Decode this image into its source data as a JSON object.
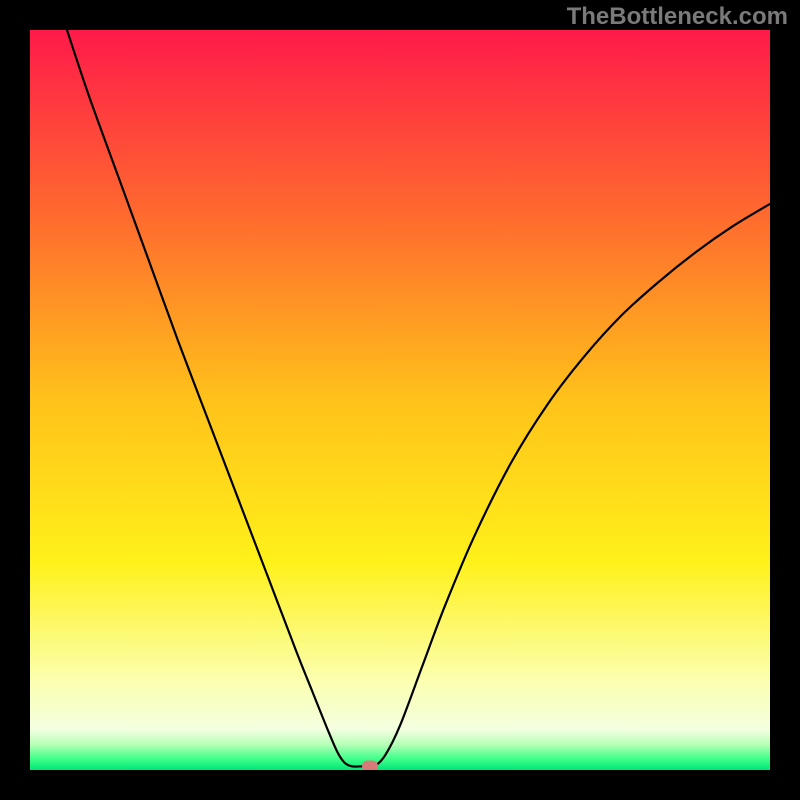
{
  "watermark": "TheBottleneck.com",
  "chart_data": {
    "type": "line",
    "title": "",
    "xlabel": "",
    "ylabel": "",
    "xlim": [
      0,
      100
    ],
    "ylim": [
      0,
      100
    ],
    "gradient_stops": [
      {
        "offset": 0.0,
        "color": "#ff1a4a"
      },
      {
        "offset": 0.25,
        "color": "#ff6a2e"
      },
      {
        "offset": 0.5,
        "color": "#ffc21a"
      },
      {
        "offset": 0.72,
        "color": "#fff11a"
      },
      {
        "offset": 0.88,
        "color": "#fbffb0"
      },
      {
        "offset": 0.945,
        "color": "#f4ffe0"
      },
      {
        "offset": 0.965,
        "color": "#b8ffb8"
      },
      {
        "offset": 0.985,
        "color": "#3fff8a"
      },
      {
        "offset": 1.0,
        "color": "#00e676"
      }
    ],
    "series": [
      {
        "name": "bottleneck-curve",
        "color": "#000000",
        "points": [
          {
            "x": 5.0,
            "y": 100.0
          },
          {
            "x": 8.0,
            "y": 91.0
          },
          {
            "x": 12.0,
            "y": 80.0
          },
          {
            "x": 16.0,
            "y": 69.0
          },
          {
            "x": 20.0,
            "y": 58.0
          },
          {
            "x": 24.0,
            "y": 47.5
          },
          {
            "x": 28.0,
            "y": 37.0
          },
          {
            "x": 32.0,
            "y": 26.5
          },
          {
            "x": 36.0,
            "y": 16.0
          },
          {
            "x": 38.0,
            "y": 11.0
          },
          {
            "x": 40.0,
            "y": 6.0
          },
          {
            "x": 41.5,
            "y": 2.5
          },
          {
            "x": 42.5,
            "y": 1.0
          },
          {
            "x": 43.5,
            "y": 0.5
          },
          {
            "x": 45.0,
            "y": 0.5
          },
          {
            "x": 46.5,
            "y": 0.5
          },
          {
            "x": 48.0,
            "y": 2.0
          },
          {
            "x": 50.0,
            "y": 6.0
          },
          {
            "x": 53.0,
            "y": 14.0
          },
          {
            "x": 56.0,
            "y": 22.0
          },
          {
            "x": 60.0,
            "y": 31.5
          },
          {
            "x": 65.0,
            "y": 41.5
          },
          {
            "x": 70.0,
            "y": 49.5
          },
          {
            "x": 75.0,
            "y": 56.0
          },
          {
            "x": 80.0,
            "y": 61.5
          },
          {
            "x": 85.0,
            "y": 66.0
          },
          {
            "x": 90.0,
            "y": 70.0
          },
          {
            "x": 95.0,
            "y": 73.5
          },
          {
            "x": 100.0,
            "y": 76.5
          }
        ]
      }
    ],
    "marker": {
      "x": 46.0,
      "y": 0.5,
      "color": "#d87a78"
    }
  }
}
